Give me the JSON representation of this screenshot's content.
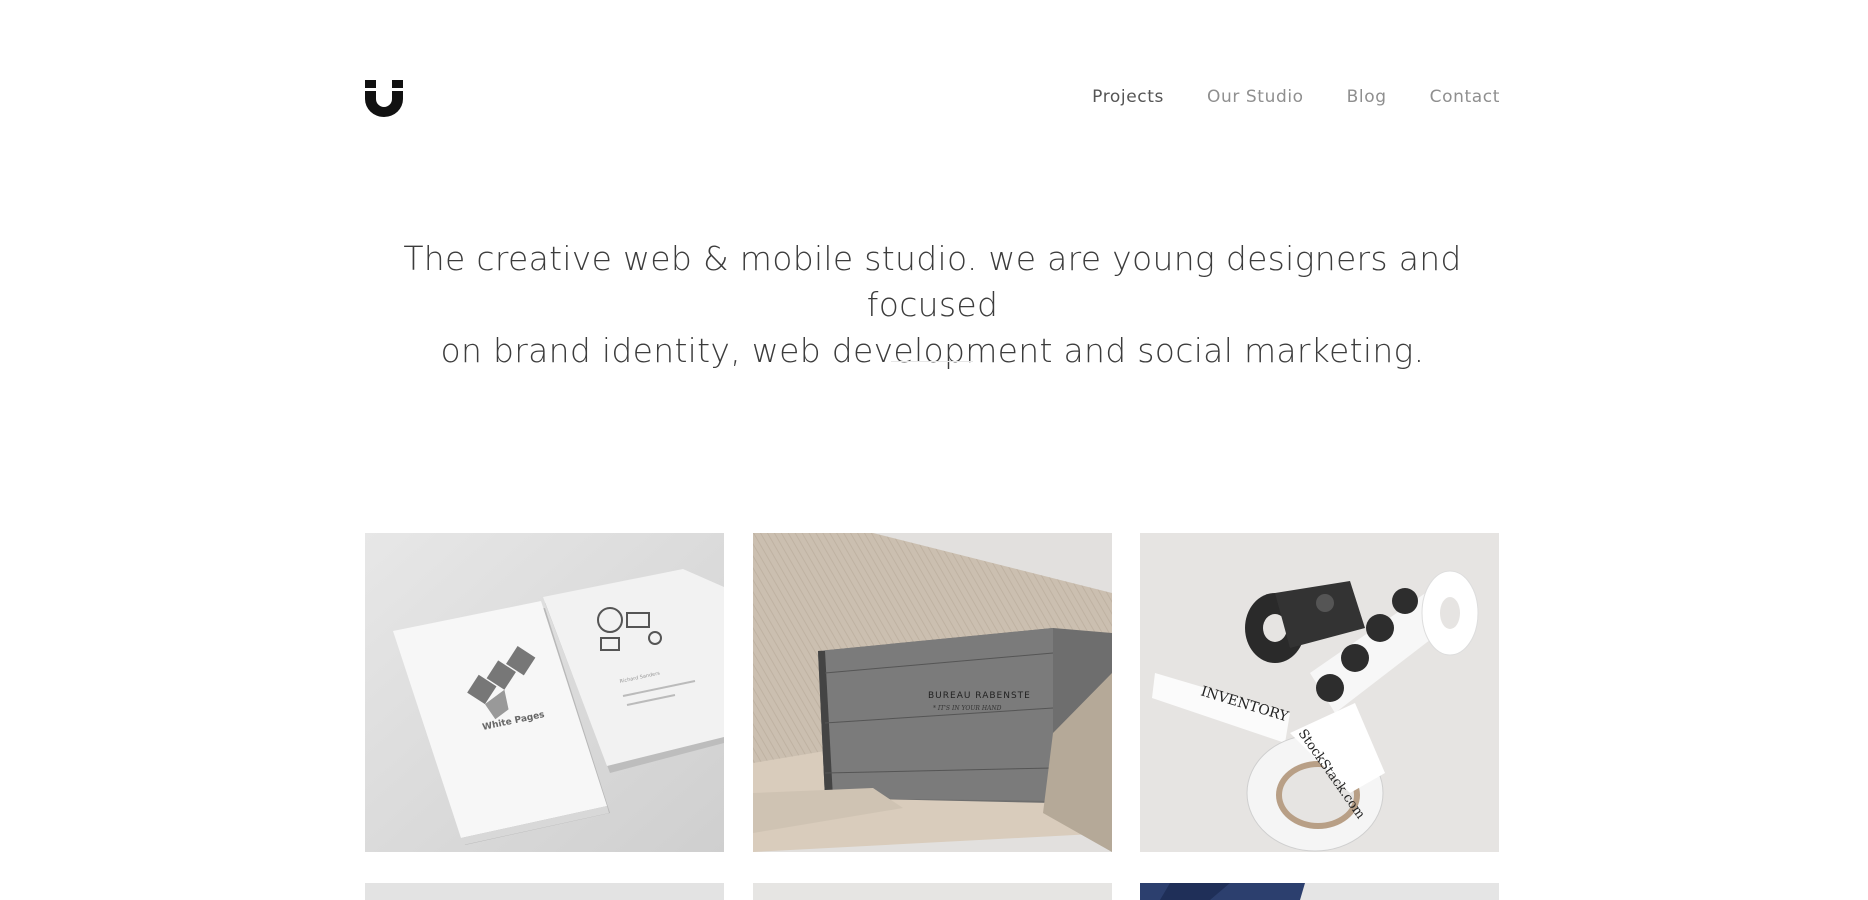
{
  "header": {
    "logo_icon": "u-magnet-logo-icon",
    "nav": [
      {
        "label": "Projects",
        "active": true
      },
      {
        "label": "Our Studio",
        "active": false
      },
      {
        "label": "Blog",
        "active": false
      },
      {
        "label": "Contact",
        "active": false
      }
    ]
  },
  "hero": {
    "line1": "The creative web & mobile studio. we are young designers and focused",
    "line2": "on brand identity, web development and social marketing."
  },
  "projects": [
    {
      "image": "business-cards-mockup",
      "logo_text": "White Pages",
      "contact_name": "Richard Sanders"
    },
    {
      "image": "kraft-paper-box-mockup",
      "box_text": "BUREAU RABENSTE",
      "box_subtext": "* IT'S IN YOUR HAND"
    },
    {
      "image": "sticker-tape-rolls-mockup",
      "tape_text": "INVENTORY",
      "tape_subtext": "StockStack.com"
    },
    {
      "image": "project-thumbnail-4"
    },
    {
      "image": "project-thumbnail-5"
    },
    {
      "image": "project-thumbnail-6"
    }
  ],
  "colors": {
    "background": "#ffffff",
    "text": "#3c3c3c",
    "nav_active": "#555555",
    "nav_inactive": "#8f8f8f"
  }
}
